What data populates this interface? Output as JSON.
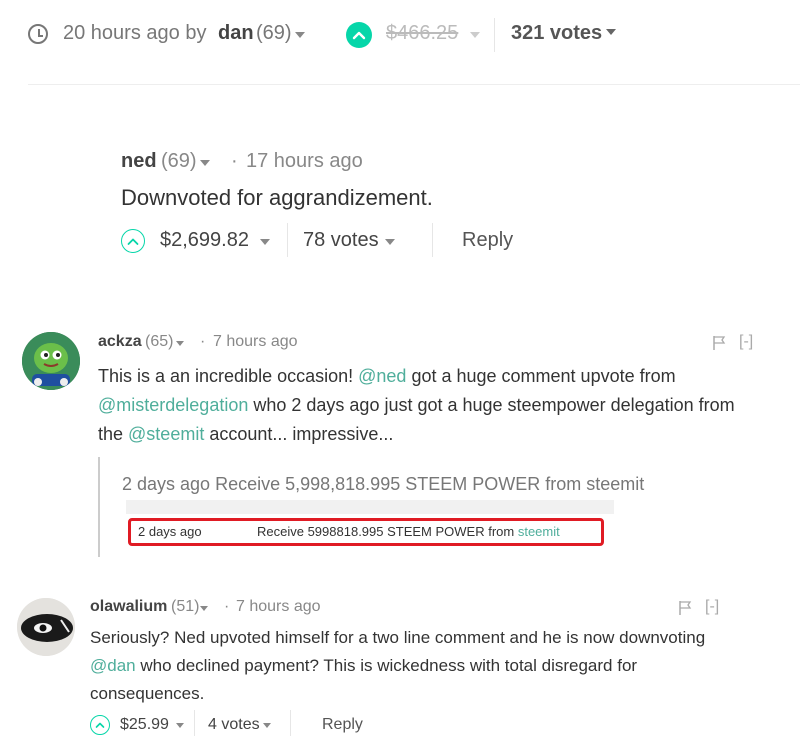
{
  "top": {
    "time": "20 hours ago by",
    "author": "dan",
    "rep": "(69)",
    "payout": "$466.25",
    "votes": "321 votes"
  },
  "ned_comment": {
    "author": "ned",
    "rep": "(69)",
    "dot": "·",
    "time": "17 hours ago",
    "body": "Downvoted for aggrandizement.",
    "payout": "$2,699.82",
    "votes": "78 votes",
    "reply": "Reply"
  },
  "ackza_comment": {
    "author": "ackza",
    "rep": "(65)",
    "dot": "·",
    "time": "7 hours ago",
    "collapse": "[-]",
    "line1_pre": "This is a an incredible occasion! ",
    "mention_ned": "@ned",
    "line1_post": " got a huge comment upvote from",
    "mention_misterdelegation": "@misterdelegation",
    "line2_post": " who 2 days ago just got a huge steempower delegation from",
    "line3_pre": "the ",
    "mention_steemit": "@steemit",
    "line3_post": " account... impressive...",
    "quote": "2 days ago Receive 5,998,818.995 STEEM POWER from steemit",
    "shot_date": "2 days ago",
    "shot_text": "Receive 5998818.995 STEEM POWER from ",
    "shot_link": "steemit"
  },
  "olawalium_comment": {
    "author": "olawalium",
    "rep": "(51)",
    "dot": "·",
    "time": "7 hours ago",
    "collapse": "[-]",
    "line1": "Seriously? Ned upvoted himself for a two line comment and he is now downvoting",
    "mention_dan": "@dan",
    "line2_post": " who declined payment? This is wickedness with total disregard for",
    "line3": "consequences.",
    "payout": "$25.99",
    "votes": "4 votes",
    "reply": "Reply"
  },
  "colors": {
    "accent": "#06d6a9",
    "link": "#4fae9b",
    "highlight_box": "#e01b24"
  }
}
